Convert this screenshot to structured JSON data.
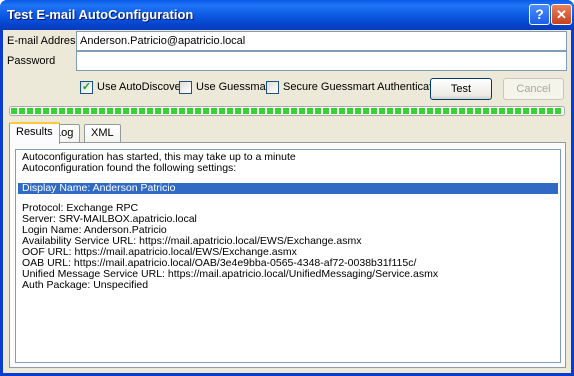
{
  "window": {
    "title": "Test E-mail AutoConfiguration",
    "help_glyph": "?",
    "close_glyph": "✕"
  },
  "form": {
    "email_label": "E-mail Address",
    "email_value": "Anderson.Patricio@apatricio.local",
    "password_label": "Password",
    "password_value": ""
  },
  "options": {
    "use_autodiscover": {
      "label": "Use AutoDiscover",
      "checked": true
    },
    "use_guessmart": {
      "label": "Use Guessmart",
      "checked": false
    },
    "secure_guessmart": {
      "label": "Secure Guessmart Authentication",
      "checked": false
    }
  },
  "buttons": {
    "test": "Test",
    "cancel": "Cancel"
  },
  "progress": {
    "fraction": 1.0,
    "color": "#37d233"
  },
  "tabs": [
    {
      "label": "Results",
      "active": true
    },
    {
      "label": "Log",
      "active": false
    },
    {
      "label": "XML",
      "active": false
    }
  ],
  "results": {
    "lines": [
      "Autoconfiguration has started, this may take up to a minute",
      "Autoconfiguration found the following settings:",
      "",
      "Display Name: Anderson Patricio",
      "",
      "Protocol: Exchange RPC",
      "Server: SRV-MAILBOX.apatricio.local",
      "Login Name: Anderson.Patricio",
      "Availability Service URL: https://mail.apatricio.local/EWS/Exchange.asmx",
      "OOF URL: https://mail.apatricio.local/EWS/Exchange.asmx",
      "OAB URL: https://mail.apatricio.local/OAB/3e4e9bba-0565-4348-af72-0038b31f115c/",
      "Unified Message Service URL: https://mail.apatricio.local/UnifiedMessaging/Service.asmx",
      "Auth Package: Unspecified"
    ],
    "selected_index": 3
  }
}
